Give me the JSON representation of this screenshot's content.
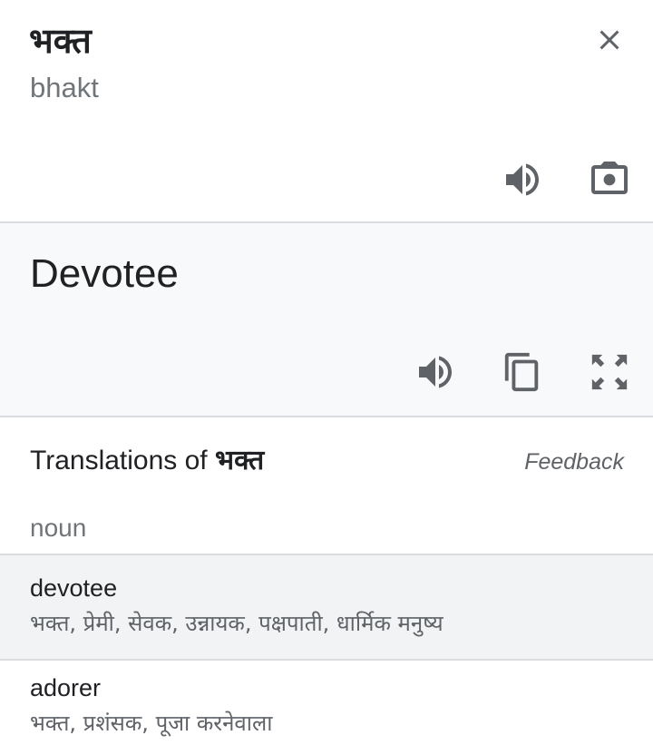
{
  "source": {
    "word": "भक्त",
    "transliteration": "bhakt",
    "icons": {
      "close": "close-icon",
      "speak": "speaker-icon",
      "camera": "camera-icon"
    }
  },
  "target": {
    "word": "Devotee",
    "icons": {
      "speak": "speaker-icon",
      "copy": "copy-icon",
      "fullscreen": "fullscreen-icon"
    }
  },
  "dictionary": {
    "title_prefix": "Translations of ",
    "title_word": "भक्त",
    "feedback_label": "Feedback",
    "part_of_speech": "noun",
    "entries": [
      {
        "word": "devotee",
        "synonyms": "भक्त, प्रेमी, सेवक, उन्नायक, पक्षपाती, धार्मिक मनुष्य"
      },
      {
        "word": "adorer",
        "synonyms": "भक्त, प्रशंसक, पूजा करनेवाला"
      }
    ]
  },
  "colors": {
    "icon": "#5f6368",
    "divider": "#dadce0",
    "target_bg": "#f8f9fa",
    "highlight_bg": "#f1f3f4"
  }
}
